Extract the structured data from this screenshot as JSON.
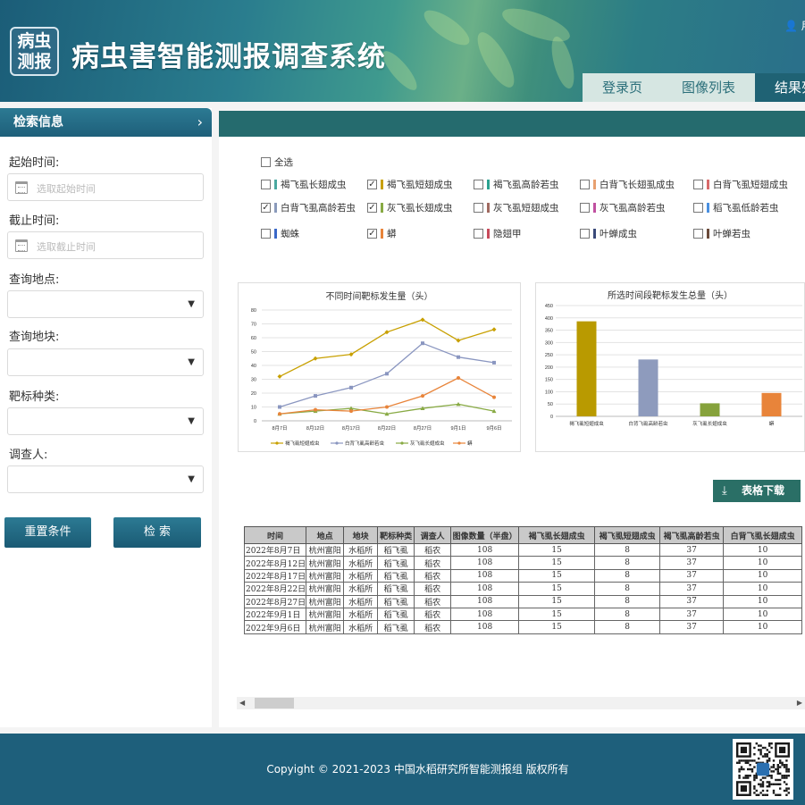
{
  "header": {
    "logo_line1": "病虫",
    "logo_line2": "测报",
    "title": "病虫害智能测报调查系统",
    "user": "用",
    "tabs": [
      {
        "label": "登录页",
        "active": false
      },
      {
        "label": "图像列表",
        "active": false
      },
      {
        "label": "结果列",
        "active": true
      }
    ]
  },
  "sidebar": {
    "title": "检索信息",
    "fields": [
      {
        "label": "起始时间:",
        "type": "date",
        "placeholder": "选取起始时间",
        "icon": "calendar-icon"
      },
      {
        "label": "截止时间:",
        "type": "date",
        "placeholder": "选取截止时间",
        "icon": "calendar-icon"
      },
      {
        "label": "查询地点:",
        "type": "select",
        "value": ""
      },
      {
        "label": "查询地块:",
        "type": "select",
        "value": ""
      },
      {
        "label": "靶标种类:",
        "type": "select",
        "value": ""
      },
      {
        "label": "调查人:",
        "type": "select",
        "value": ""
      }
    ],
    "reset_label": "重置条件",
    "search_label": "检 索"
  },
  "filters": {
    "select_all": "全选",
    "items": [
      {
        "label": "褐飞虱长翅成虫",
        "checked": false,
        "color": "#4aa8a0"
      },
      {
        "label": "褐飞虱短翅成虫",
        "checked": true,
        "color": "#c8a000"
      },
      {
        "label": "褐飞虱高龄若虫",
        "checked": false,
        "color": "#2aa18f"
      },
      {
        "label": "白背飞长翅虱成虫",
        "checked": false,
        "color": "#e8a070"
      },
      {
        "label": "白背飞虱短翅成虫",
        "checked": false,
        "color": "#d86a6a"
      },
      {
        "label": "白背飞虱高龄若虫",
        "checked": true,
        "color": "#8a9abb"
      },
      {
        "label": "灰飞虱长翅成虫",
        "checked": true,
        "color": "#88aa44"
      },
      {
        "label": "灰飞虱短翅成虫",
        "checked": false,
        "color": "#a06a60"
      },
      {
        "label": "灰飞虱高龄若虫",
        "checked": false,
        "color": "#c050a0"
      },
      {
        "label": "稻飞虱低龄若虫",
        "checked": false,
        "color": "#4a90e0"
      },
      {
        "label": "蜘蛛",
        "checked": false,
        "color": "#3a68c8"
      },
      {
        "label": "蟒",
        "checked": true,
        "color": "#e8843a"
      },
      {
        "label": "隐翅甲",
        "checked": false,
        "color": "#c84a5a"
      },
      {
        "label": "叶蝉成虫",
        "checked": false,
        "color": "#3a4a7a"
      },
      {
        "label": "叶蝉若虫",
        "checked": false,
        "color": "#6a4a3a"
      }
    ]
  },
  "chart_data": [
    {
      "type": "line",
      "title": "不同时间靶标发生量（头）",
      "categories": [
        "8月7日",
        "8月12日",
        "8月17日",
        "8月22日",
        "8月27日",
        "9月1日",
        "9月6日"
      ],
      "ylim": [
        0,
        80
      ],
      "yticks": [
        0,
        10,
        20,
        30,
        40,
        50,
        60,
        70,
        80
      ],
      "grid": true,
      "legend": "bottom",
      "series": [
        {
          "name": "褐飞虱短翅成虫",
          "color": "#c8a000",
          "marker": "diamond",
          "values": [
            32,
            45,
            48,
            64,
            73,
            58,
            66
          ]
        },
        {
          "name": "白背飞虱高龄若虫",
          "color": "#8a96c0",
          "marker": "square",
          "values": [
            10,
            18,
            24,
            34,
            56,
            46,
            42
          ]
        },
        {
          "name": "灰飞虱长翅成虫",
          "color": "#88aa44",
          "marker": "triangle",
          "values": [
            5,
            7,
            9,
            5,
            9,
            12,
            7
          ]
        },
        {
          "name": "蟒",
          "color": "#e8843a",
          "marker": "circle",
          "values": [
            5,
            8,
            7,
            10,
            18,
            31,
            17
          ]
        }
      ]
    },
    {
      "type": "bar",
      "title": "所选时间段靶标发生总量（头）",
      "categories": [
        "褐飞虱短翅成虫",
        "白背飞虱高龄若虫",
        "灰飞虱长翅成虫",
        "蟒"
      ],
      "values": [
        386,
        231,
        53,
        95
      ],
      "colors": [
        "#b99a00",
        "#8e9bbd",
        "#86a23c",
        "#e8843a"
      ],
      "ylim": [
        0,
        450
      ],
      "yticks": [
        0,
        50,
        100,
        150,
        200,
        250,
        300,
        350,
        400,
        450
      ],
      "grid": true
    },
    {
      "type": "table",
      "columns": [
        "时间",
        "地点",
        "地块",
        "靶标种类",
        "调查人",
        "图像数量（半盘）",
        "褐飞虱长翅成虫",
        "褐飞虱短翅成虫",
        "褐飞虱高龄若虫",
        "白背飞虱长翅成虫"
      ],
      "rows": [
        [
          "2022年8月7日",
          "杭州富阳",
          "水稻所",
          "稻飞虱",
          "稻农",
          "108",
          "15",
          "8",
          "37",
          "10"
        ],
        [
          "2022年8月12日",
          "杭州富阳",
          "水稻所",
          "稻飞虱",
          "稻农",
          "108",
          "15",
          "8",
          "37",
          "10"
        ],
        [
          "2022年8月17日",
          "杭州富阳",
          "水稻所",
          "稻飞虱",
          "稻农",
          "108",
          "15",
          "8",
          "37",
          "10"
        ],
        [
          "2022年8月22日",
          "杭州富阳",
          "水稻所",
          "稻飞虱",
          "稻农",
          "108",
          "15",
          "8",
          "37",
          "10"
        ],
        [
          "2022年8月27日",
          "杭州富阳",
          "水稻所",
          "稻飞虱",
          "稻农",
          "108",
          "15",
          "8",
          "37",
          "10"
        ],
        [
          "2022年9月1日",
          "杭州富阳",
          "水稻所",
          "稻飞虱",
          "稻农",
          "108",
          "15",
          "8",
          "37",
          "10"
        ],
        [
          "2022年9月6日",
          "杭州富阳",
          "水稻所",
          "稻飞虱",
          "稻农",
          "108",
          "15",
          "8",
          "37",
          "10"
        ]
      ]
    }
  ],
  "download_label": "表格下载",
  "footer": {
    "copyright": "Copyight © 2021-2023 中国水稻研究所智能测报组 版权所有"
  }
}
